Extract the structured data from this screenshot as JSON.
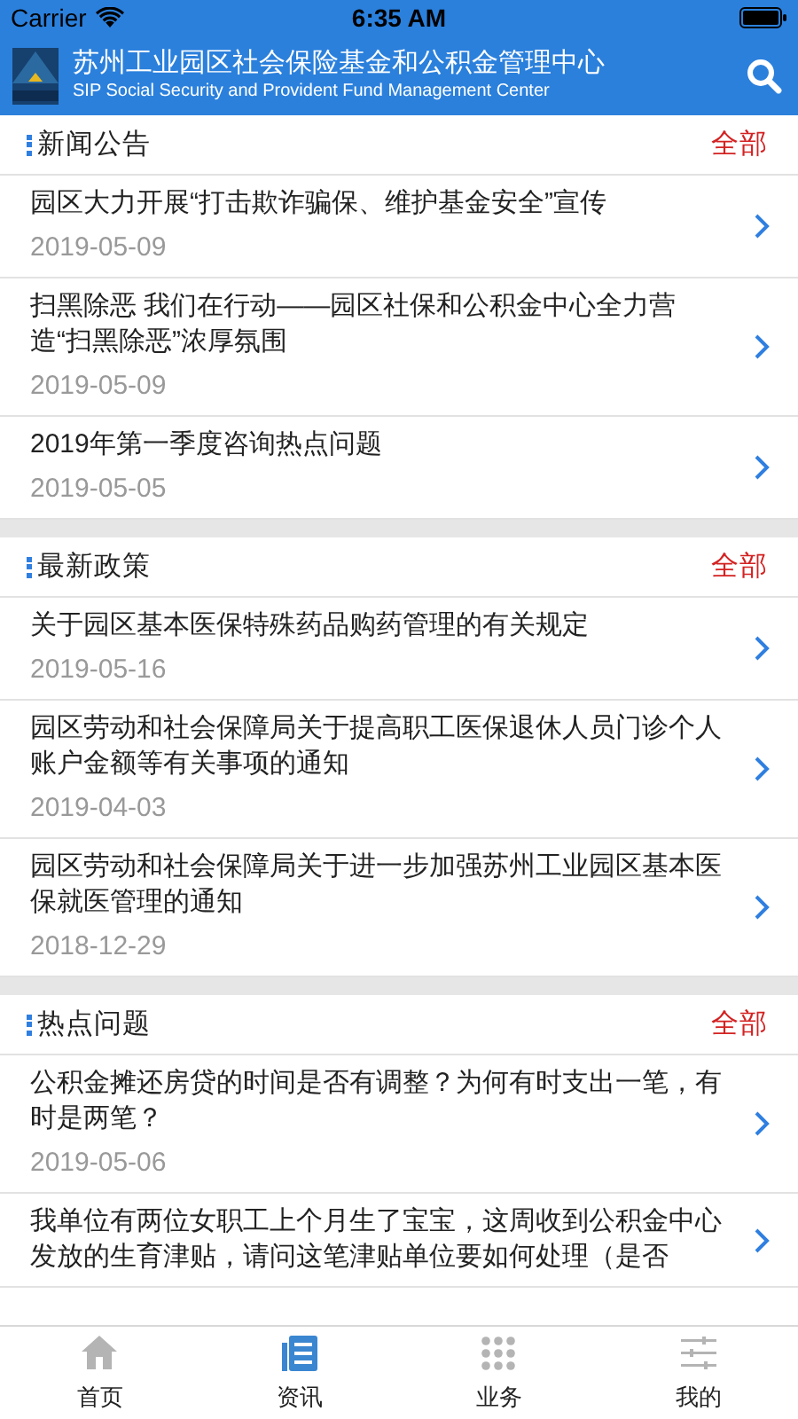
{
  "status_bar": {
    "carrier": "Carrier",
    "time": "6:35 AM"
  },
  "header": {
    "title": "苏州工业园区社会保险基金和公积金管理中心",
    "subtitle": "SIP Social Security and Provident Fund Management Center"
  },
  "sections": [
    {
      "title": "新闻公告",
      "more": "全部",
      "items": [
        {
          "title": "园区大力开展“打击欺诈骗保、维护基金安全”宣传",
          "date": "2019-05-09"
        },
        {
          "title": "扫黑除恶 我们在行动——园区社保和公积金中心全力营造“扫黑除恶”浓厚氛围",
          "date": "2019-05-09"
        },
        {
          "title": "2019年第一季度咨询热点问题",
          "date": "2019-05-05"
        }
      ]
    },
    {
      "title": "最新政策",
      "more": "全部",
      "items": [
        {
          "title": "关于园区基本医保特殊药品购药管理的有关规定",
          "date": "2019-05-16"
        },
        {
          "title": "园区劳动和社会保障局关于提高职工医保退休人员门诊个人账户金额等有关事项的通知",
          "date": "2019-04-03"
        },
        {
          "title": "园区劳动和社会保障局关于进一步加强苏州工业园区基本医保就医管理的通知",
          "date": "2018-12-29"
        }
      ]
    },
    {
      "title": "热点问题",
      "more": "全部",
      "items": [
        {
          "title": "公积金摊还房贷的时间是否有调整？为何有时支出一笔，有时是两笔？",
          "date": "2019-05-06"
        },
        {
          "title": "我单位有两位女职工上个月生了宝宝，这周收到公积金中心发放的生育津贴，请问这笔津贴单位要如何处理（是否"
        }
      ]
    }
  ],
  "tabs": [
    {
      "kind": "home",
      "label": "首页",
      "selected": false
    },
    {
      "kind": "news",
      "label": "资讯",
      "selected": true
    },
    {
      "kind": "service",
      "label": "业务",
      "selected": false
    },
    {
      "kind": "mine",
      "label": "我的",
      "selected": false
    }
  ]
}
